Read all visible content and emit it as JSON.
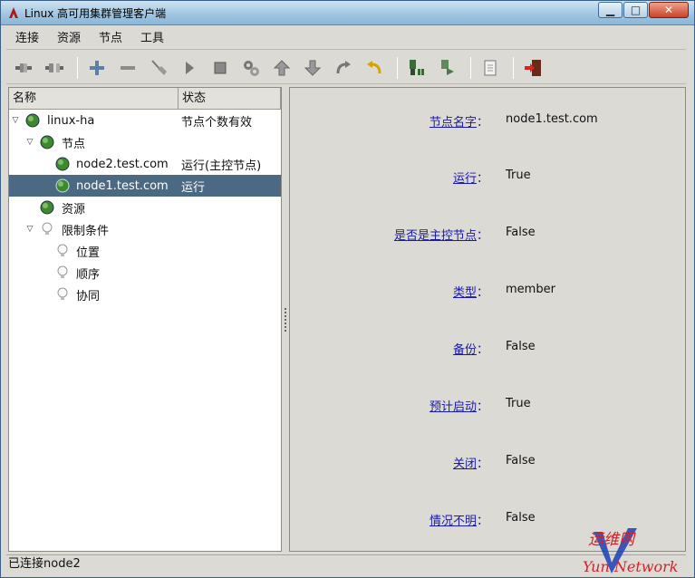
{
  "window": {
    "title": "Linux 高可用集群管理客户端",
    "controls": {
      "minimize": "▁",
      "maximize": "□",
      "close": "✕"
    }
  },
  "menubar": {
    "items": [
      {
        "label": "连接"
      },
      {
        "label": "资源"
      },
      {
        "label": "节点"
      },
      {
        "label": "工具"
      }
    ]
  },
  "toolbar": {
    "buttons": [
      {
        "icon": "connect-icon"
      },
      {
        "icon": "disconnect-icon"
      },
      {
        "icon": "add-icon"
      },
      {
        "icon": "remove-icon"
      },
      {
        "icon": "cleanup-broom-icon"
      },
      {
        "icon": "start-play-icon"
      },
      {
        "icon": "stop-square-icon"
      },
      {
        "icon": "migrate-gears-icon"
      },
      {
        "icon": "move-up-icon"
      },
      {
        "icon": "move-down-icon"
      },
      {
        "icon": "redo-icon"
      },
      {
        "icon": "undo-icon"
      },
      {
        "icon": "standby-node-icon"
      },
      {
        "icon": "active-node-icon"
      },
      {
        "icon": "log-document-icon"
      },
      {
        "icon": "exit-door-icon"
      }
    ]
  },
  "tree": {
    "headers": {
      "name": "名称",
      "status": "状态"
    },
    "rows": [
      {
        "label": "linux-ha",
        "status": "节点个数有效"
      },
      {
        "label": "节点",
        "status": ""
      },
      {
        "label": "node2.test.com",
        "status": "运行(主控节点)"
      },
      {
        "label": "node1.test.com",
        "status": "运行"
      },
      {
        "label": "资源",
        "status": ""
      },
      {
        "label": "限制条件",
        "status": ""
      },
      {
        "label": "位置",
        "status": ""
      },
      {
        "label": "顺序",
        "status": ""
      },
      {
        "label": "协同",
        "status": ""
      }
    ]
  },
  "details": {
    "colon": "：",
    "items": [
      {
        "key": "节点名字",
        "value": "node1.test.com"
      },
      {
        "key": "运行",
        "value": "True"
      },
      {
        "key": "是否是主控节点",
        "value": "False"
      },
      {
        "key": "类型",
        "value": "member"
      },
      {
        "key": "备份",
        "value": "False"
      },
      {
        "key": "预计启动",
        "value": "True"
      },
      {
        "key": "关闭",
        "value": "False"
      },
      {
        "key": "情况不明",
        "value": "False"
      }
    ]
  },
  "statusbar": {
    "text": "已连接node2"
  },
  "watermark": {
    "line1": "运维网",
    "line2": "Yun Network"
  },
  "colors": {
    "selection": "#4b6983",
    "link": "#1a1aa8",
    "node_green": "#3b8a2c",
    "watermark_red": "#d2222a",
    "watermark_blue": "#1c3fb5"
  }
}
